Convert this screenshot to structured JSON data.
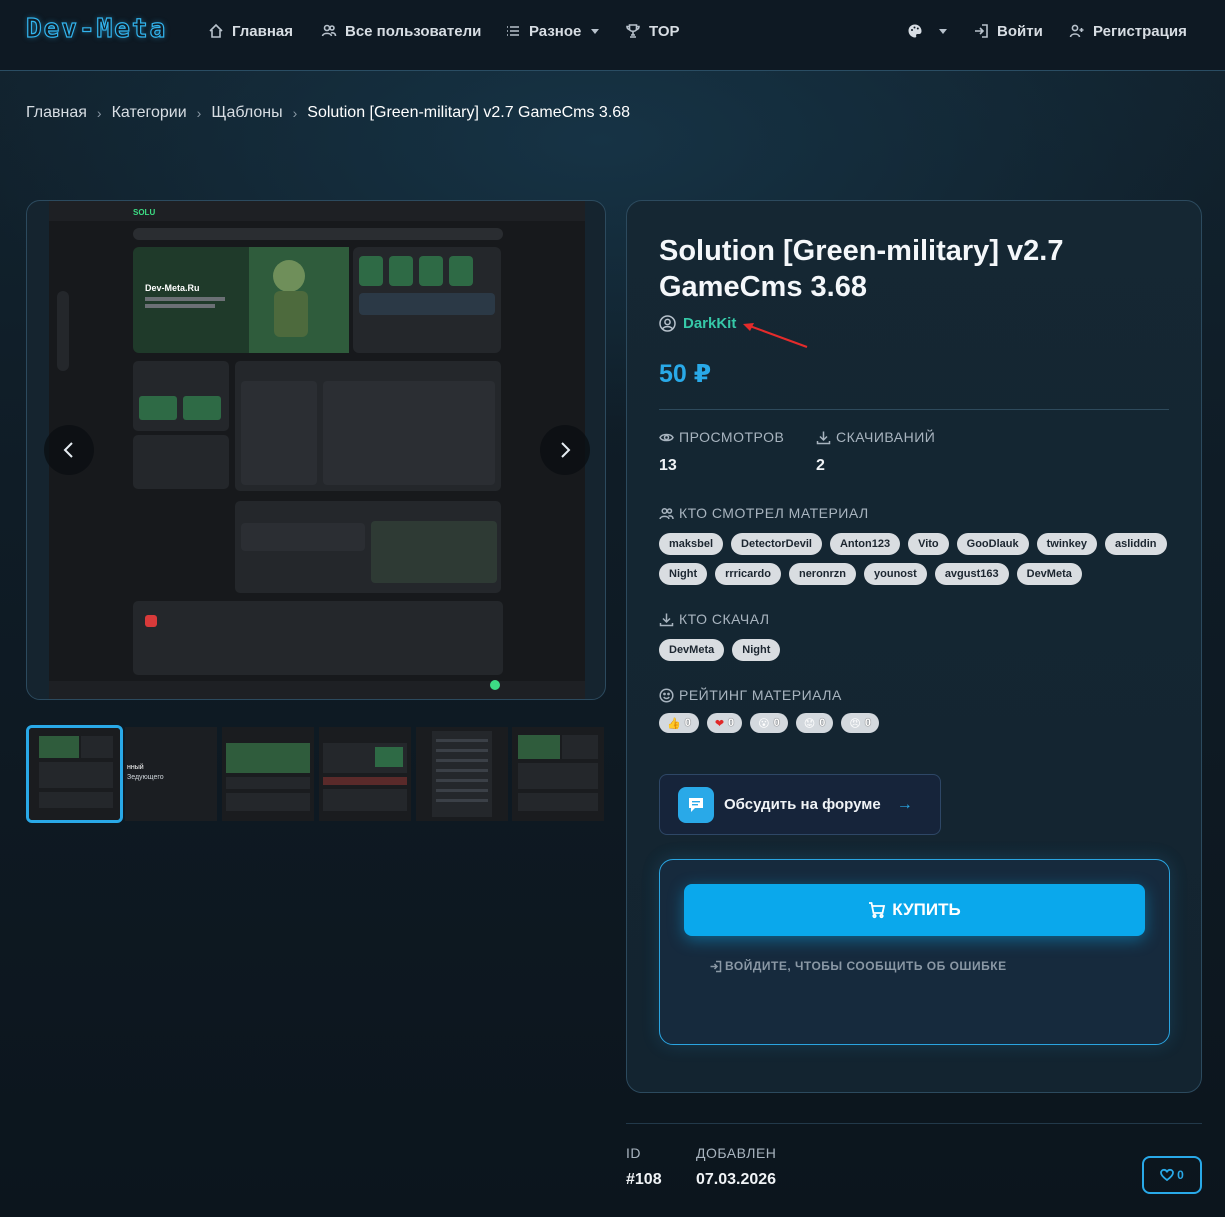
{
  "nav": {
    "logo": "Dev-Meta",
    "home": "Главная",
    "users": "Все пользователи",
    "misc": "Разное",
    "top": "TOP",
    "login": "Войти",
    "register": "Регистрация"
  },
  "breadcrumb": {
    "items": [
      "Главная",
      "Категории",
      "Щаблоны"
    ],
    "current": "Solution [Green-military] v2.7 GameCms 3.68"
  },
  "product": {
    "title": "Solution [Green-military] v2.7 GameCms 3.68",
    "author": "DarkKit",
    "price": "50 ₽",
    "views_label": "ПРОСМОТРОВ",
    "views": "13",
    "downloads_label": "СКАЧИВАНИЙ",
    "downloads": "2",
    "viewers_label": "КТО СМОТРЕЛ МАТЕРИАЛ",
    "viewers": [
      "maksbel",
      "DetectorDevil",
      "Anton123",
      "Vito",
      "GooDlauk",
      "twinkey",
      "asliddin",
      "Night",
      "rrricardo",
      "neronrzn",
      "younost",
      "avgust163",
      "DevMeta"
    ],
    "downloaders_label": "КТО СКАЧАЛ",
    "downloaders": [
      "DevMeta",
      "Night"
    ],
    "rating_label": "РЕЙТИНГ МАТЕРИАЛА",
    "reactions": [
      {
        "icon": "thumbs-up-icon",
        "count": "0"
      },
      {
        "icon": "heart-icon",
        "count": "0"
      },
      {
        "icon": "surprised-icon",
        "count": "0"
      },
      {
        "icon": "sad-icon",
        "count": "0"
      },
      {
        "icon": "angry-icon",
        "count": "0"
      }
    ],
    "forum_label": "Обсудить на форуме",
    "buy_label": "КУПИТЬ",
    "report_label": "ВОЙДИТЕ, ЧТОБЫ СООБЩИТЬ ОБ ОШИБКЕ"
  },
  "meta": {
    "id_label": "ID",
    "id": "#108",
    "added_label": "ДОБАВЛЕН",
    "added": "07.03.2026",
    "likes": "0"
  },
  "preview": {
    "site_name": "Dev-Meta.Ru",
    "thumb_text": "нный\nЗедующего"
  },
  "colors": {
    "accent": "#29a9e8",
    "author": "#36c9a8",
    "price": "#29a9e8",
    "tag_bg": "#d9dde1"
  }
}
